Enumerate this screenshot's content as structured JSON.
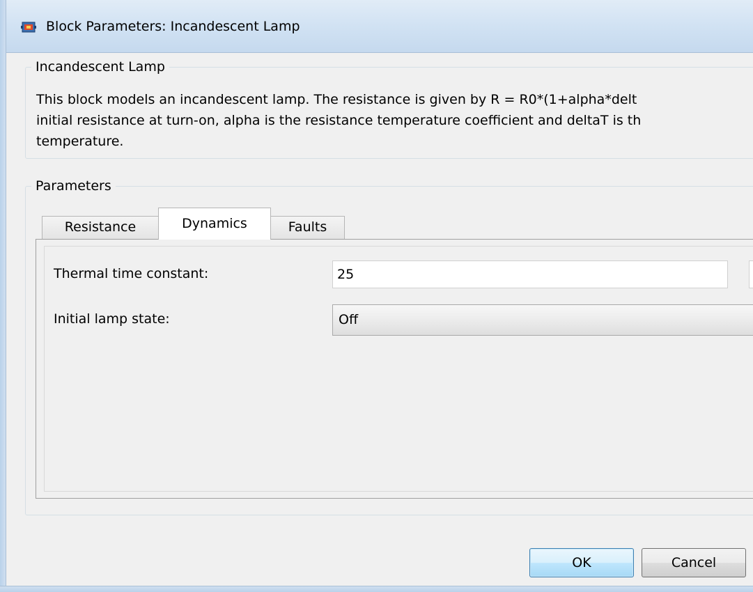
{
  "window": {
    "title": "Block Parameters: Incandescent Lamp"
  },
  "description": {
    "group_title": "Incandescent Lamp",
    "text": "This block models an incandescent lamp. The resistance is given by R = R0*(1+alpha*delt\ninitial resistance at turn-on, alpha is the resistance temperature coefficient and deltaT is th\ntemperature."
  },
  "parameters": {
    "group_title": "Parameters",
    "tabs": [
      {
        "label": "Resistance",
        "active": false
      },
      {
        "label": "Dynamics",
        "active": true
      },
      {
        "label": "Faults",
        "active": false
      }
    ],
    "fields": {
      "thermal_time_constant": {
        "label": "Thermal time constant:",
        "value": "25"
      },
      "initial_lamp_state": {
        "label": "Initial lamp state:",
        "value": "Off"
      }
    }
  },
  "buttons": {
    "ok": "OK",
    "cancel": "Cancel"
  },
  "colors": {
    "title_bar": "#c5d9ee",
    "default_button_border": "#3c7fb1"
  }
}
